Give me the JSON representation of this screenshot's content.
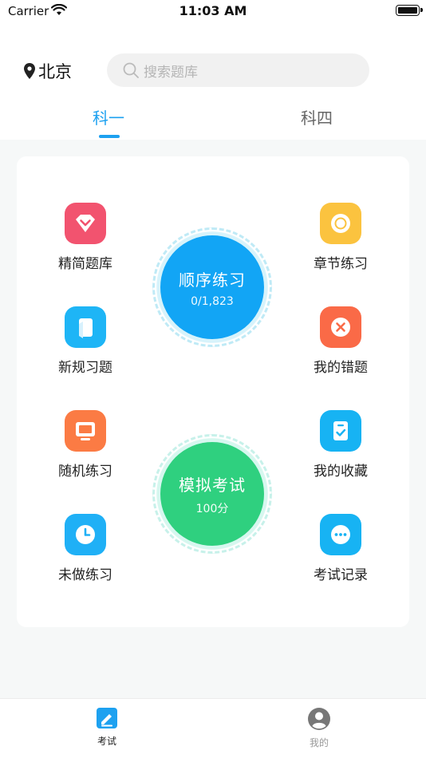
{
  "status_bar": {
    "carrier": "Carrier",
    "time": "11:03 AM"
  },
  "header": {
    "location": "北京",
    "search_placeholder": "搜索题库",
    "tabs": [
      {
        "label": "科一",
        "active": true
      },
      {
        "label": "科四",
        "active": false
      }
    ]
  },
  "practice": {
    "left_items": [
      {
        "label": "精简题库",
        "icon": "diamond-icon"
      },
      {
        "label": "新规习题",
        "icon": "book-icon"
      },
      {
        "label": "随机练习",
        "icon": "monitor-icon"
      },
      {
        "label": "未做练习",
        "icon": "clock-icon"
      }
    ],
    "right_items": [
      {
        "label": "章节练习",
        "icon": "circle-target-icon"
      },
      {
        "label": "我的错题",
        "icon": "x-circle-icon"
      },
      {
        "label": "我的收藏",
        "icon": "clipboard-check-icon"
      },
      {
        "label": "考试记录",
        "icon": "ellipsis-icon"
      }
    ],
    "sequential": {
      "title": "顺序练习",
      "progress": "0/1,823"
    },
    "mock_exam": {
      "title": "模拟考试",
      "score": "100分"
    }
  },
  "tabbar": {
    "items": [
      {
        "label": "考试",
        "icon": "exam-edit-icon",
        "active": true
      },
      {
        "label": "我的",
        "icon": "user-icon",
        "active": false
      }
    ]
  },
  "colors": {
    "accent": "#1da1f0",
    "sequential": "#12a5f5",
    "mock_exam": "#2fd07f",
    "diamond": "#f2536f",
    "circle_target": "#fbc33f",
    "book": "#1eb5f6",
    "x_circle": "#fa6a47",
    "monitor": "#fb7b44",
    "clipboard": "#17b3f3",
    "clock": "#1fb0f6",
    "ellipsis": "#17b3f3"
  }
}
